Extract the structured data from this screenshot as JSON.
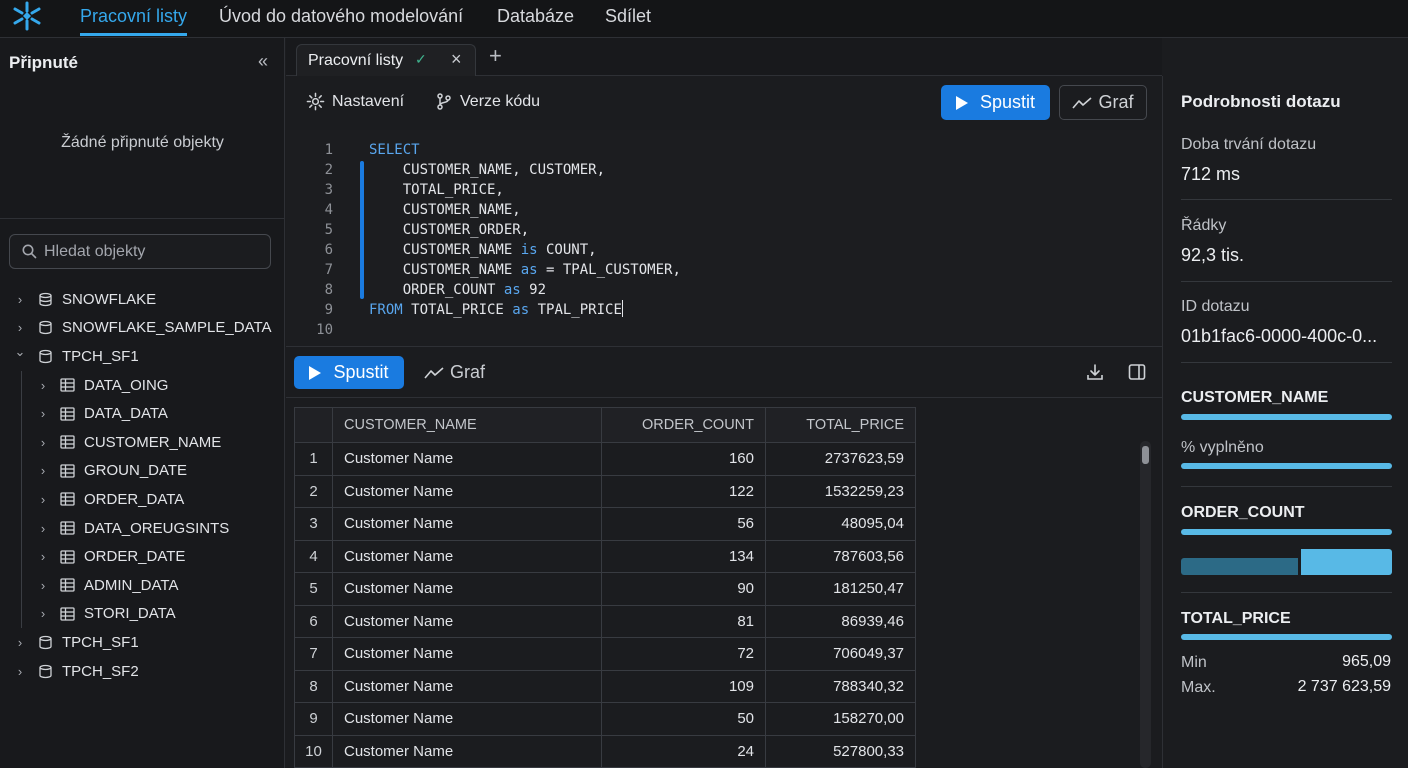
{
  "nav": {
    "items": [
      "Pracovní listy",
      "Úvod do datového modelování",
      "Databáze",
      "Sdílet"
    ],
    "active_index": 0
  },
  "sidebar": {
    "pinned_title": "Připnuté",
    "pinned_empty": "Žádné připnuté objekty",
    "search_placeholder": "Hledat objekty",
    "tree": [
      {
        "label": "SNOWFLAKE",
        "level": 0,
        "expanded": false,
        "icon": "database-stack-icon"
      },
      {
        "label": "SNOWFLAKE_SAMPLE_DATA",
        "level": 0,
        "expanded": false,
        "icon": "database-icon"
      },
      {
        "label": "TPCH_SF1",
        "level": 0,
        "expanded": true,
        "icon": "database-icon"
      },
      {
        "label": "DATA_OING",
        "level": 1,
        "expanded": false,
        "icon": "table-icon"
      },
      {
        "label": "DATA_DATA",
        "level": 1,
        "expanded": false,
        "icon": "table-icon"
      },
      {
        "label": "CUSTOMER_NAME",
        "level": 1,
        "expanded": false,
        "icon": "table-icon"
      },
      {
        "label": "GROUN_DATE",
        "level": 1,
        "expanded": false,
        "icon": "table-icon"
      },
      {
        "label": "ORDER_DATA",
        "level": 1,
        "expanded": false,
        "icon": "table-icon"
      },
      {
        "label": "DATA_OREUGSINTS",
        "level": 1,
        "expanded": false,
        "icon": "table-icon"
      },
      {
        "label": "ORDER_DATE",
        "level": 1,
        "expanded": false,
        "icon": "table-icon"
      },
      {
        "label": "ADMIN_DATA",
        "level": 1,
        "expanded": false,
        "icon": "table-icon"
      },
      {
        "label": "STORI_DATA",
        "level": 1,
        "expanded": false,
        "icon": "table-icon"
      },
      {
        "label": "TPCH_SF1",
        "level": 0,
        "expanded": false,
        "icon": "database-icon"
      },
      {
        "label": "TPCH_SF2",
        "level": 0,
        "expanded": false,
        "icon": "database-icon"
      }
    ]
  },
  "tab": {
    "label": "Pracovní listy",
    "check": "✓",
    "close": "×",
    "add": "+"
  },
  "toolbar": {
    "settings_label": "Nastavení",
    "version_label": "Verze kódu",
    "run_label": "Spustit",
    "chart_label": "Graf"
  },
  "editor": {
    "lines": [
      [
        {
          "t": "SELECT",
          "k": true
        }
      ],
      [
        {
          "t": "    CUSTOMER_NAME, CUSTOMER,",
          "k": false
        }
      ],
      [
        {
          "t": "    TOTAL_PRICE,",
          "k": false
        }
      ],
      [
        {
          "t": "    CUSTOMER_NAME,",
          "k": false
        }
      ],
      [
        {
          "t": "    CUSTOMER_ORDER,",
          "k": false
        }
      ],
      [
        {
          "t": "    CUSTOMER_NAME ",
          "k": false
        },
        {
          "t": "is",
          "k": true
        },
        {
          "t": " COUNT,",
          "k": false
        }
      ],
      [
        {
          "t": "    CUSTOMER_NAME ",
          "k": false
        },
        {
          "t": "as",
          "k": true
        },
        {
          "t": " = TPAL_CUSTOMER,",
          "k": false
        }
      ],
      [
        {
          "t": "    ORDER_COUNT ",
          "k": false
        },
        {
          "t": "as",
          "k": true
        },
        {
          "t": " 92",
          "k": false
        }
      ],
      [
        {
          "t": "FROM",
          "k": true
        },
        {
          "t": " TOTAL_PRICE ",
          "k": false
        },
        {
          "t": "as",
          "k": true
        },
        {
          "t": " TPAL_PRICE",
          "k": false
        }
      ],
      []
    ],
    "cursor_line": 9
  },
  "results": {
    "run_label": "Spustit",
    "chart_label": "Graf",
    "columns": [
      "CUSTOMER_NAME",
      "ORDER_COUNT",
      "TOTAL_PRICE"
    ],
    "rows": [
      [
        "1",
        "Customer Name",
        "160",
        "2737623,59"
      ],
      [
        "2",
        "Customer Name",
        "122",
        "1532259,23"
      ],
      [
        "3",
        "Customer Name",
        "56",
        "48095,04"
      ],
      [
        "4",
        "Customer Name",
        "134",
        "787603,56"
      ],
      [
        "5",
        "Customer Name",
        "90",
        "181250,47"
      ],
      [
        "6",
        "Customer Name",
        "81",
        "86939,46"
      ],
      [
        "7",
        "Customer Name",
        "72",
        "706049,37"
      ],
      [
        "8",
        "Customer Name",
        "109",
        "788340,32"
      ],
      [
        "9",
        "Customer Name",
        "50",
        "158270,00"
      ],
      [
        "10",
        "Customer Name",
        "24",
        "527800,33"
      ]
    ]
  },
  "details": {
    "title": "Podrobnosti dotazu",
    "duration_label": "Doba trvání dotazu",
    "duration_value": "712 ms",
    "rows_label": "Řádky",
    "rows_value": "92,3 tis.",
    "id_label": "ID dotazu",
    "id_value": "01b1fac6-0000-400c-0...",
    "col1": "CUSTOMER_NAME",
    "filled_label": "% vyplněno",
    "col2": "ORDER_COUNT",
    "col3": "TOTAL_PRICE",
    "min_label": "Min",
    "min_value": "965,09",
    "max_label": "Max.",
    "max_value": "2 737 623,59"
  },
  "colors": {
    "accent": "#1a7be0",
    "active_nav": "#35a8ec",
    "bar": "#58b9e6",
    "keyword": "#59a6ee"
  }
}
